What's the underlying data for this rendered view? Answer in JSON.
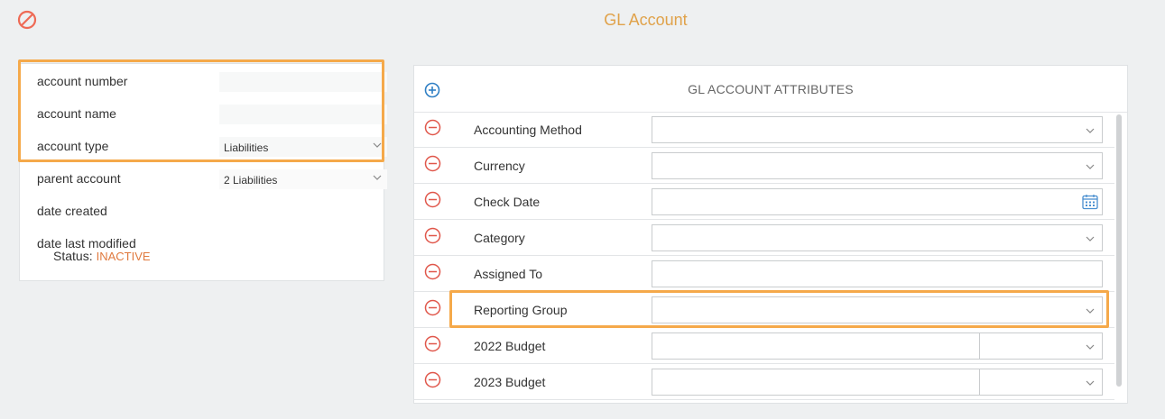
{
  "page": {
    "title": "GL Account",
    "cancel_icon": "cancel-icon"
  },
  "account_form": {
    "fields": [
      {
        "label": "account number",
        "value": ""
      },
      {
        "label": "account name",
        "value": ""
      },
      {
        "label": "account type",
        "value": "Liabilities"
      },
      {
        "label": "parent account",
        "value": "2 Liabilities"
      },
      {
        "label": "date created",
        "value": ""
      },
      {
        "label": "date last modified",
        "value": ""
      }
    ],
    "status_label": "Status:",
    "status_value": "INACTIVE"
  },
  "attributes": {
    "title": "GL ACCOUNT ATTRIBUTES",
    "add_icon": "add-circle-icon",
    "rows": [
      {
        "label": "Accounting Method",
        "control": "select",
        "value": ""
      },
      {
        "label": "Currency",
        "control": "select",
        "value": ""
      },
      {
        "label": "Check Date",
        "control": "date",
        "value": ""
      },
      {
        "label": "Category",
        "control": "select",
        "value": ""
      },
      {
        "label": "Assigned To",
        "control": "text",
        "value": ""
      },
      {
        "label": "Reporting Group",
        "control": "select",
        "value": ""
      },
      {
        "label": "2022 Budget",
        "control": "amount-select",
        "value": ""
      },
      {
        "label": "2023 Budget",
        "control": "amount-select",
        "value": ""
      }
    ]
  },
  "colors": {
    "accent": "#e0a24a",
    "highlight": "#f5a94a",
    "status_inactive": "#e07a3f",
    "remove": "#e0564a",
    "add": "#2f7fc4"
  }
}
